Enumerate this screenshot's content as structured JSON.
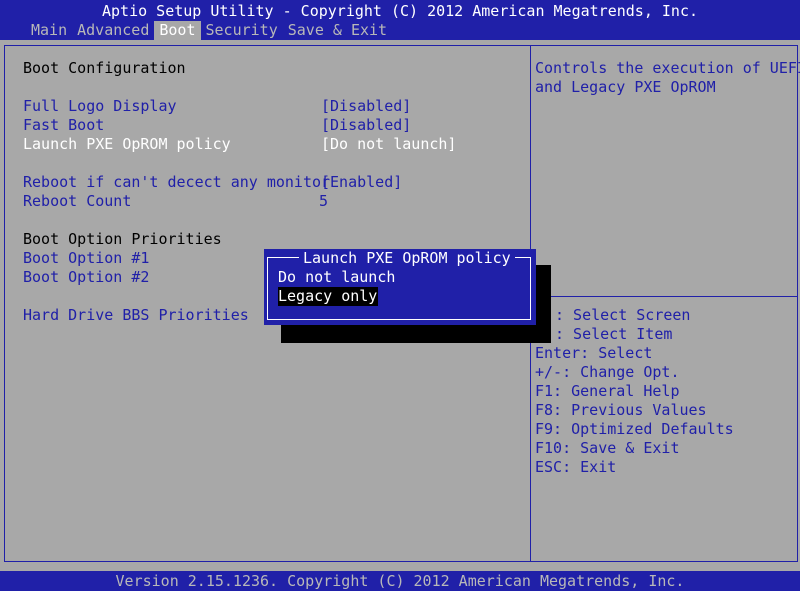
{
  "header": {
    "title": "Aptio Setup Utility - Copyright (C) 2012 American Megatrends, Inc.",
    "tabs": [
      {
        "label": "Main",
        "active": false
      },
      {
        "label": "Advanced",
        "active": false
      },
      {
        "label": "Boot",
        "active": true
      },
      {
        "label": "Security",
        "active": false
      },
      {
        "label": "Save & Exit",
        "active": false
      }
    ]
  },
  "main": {
    "section_title": "Boot Configuration",
    "settings": [
      {
        "label": "Full Logo Display",
        "value": "[Disabled]"
      },
      {
        "label": "Fast Boot",
        "value": "[Disabled]"
      },
      {
        "label": "Launch PXE OpROM policy",
        "value": "[Do not launch]"
      },
      {
        "label": "Reboot if can't decect any monitor",
        "value": "[Enabled]"
      },
      {
        "label": "Reboot Count",
        "value": "5"
      }
    ],
    "priorities_title": "Boot Option Priorities",
    "boot_options": [
      {
        "label": "Boot Option #1"
      },
      {
        "label": "Boot Option #2"
      }
    ],
    "hdd_bbs": "Hard Drive BBS Priorities"
  },
  "help": {
    "lines": [
      "Controls the execution of UEFI",
      "and Legacy PXE OpROM"
    ]
  },
  "keys": {
    "lines": [
      ": Select Screen",
      ": Select Item",
      "Enter: Select",
      "+/-: Change Opt.",
      "F1: General Help",
      "F8: Previous Values",
      "F9: Optimized Defaults",
      "F10: Save & Exit",
      "ESC: Exit"
    ]
  },
  "popup": {
    "title": "Launch PXE OpROM policy",
    "options": [
      {
        "label": "Do not launch",
        "selected": false
      },
      {
        "label": "Legacy only",
        "selected": true
      }
    ]
  },
  "footer": {
    "text": "Version 2.15.1236. Copyright (C) 2012 American Megatrends, Inc."
  },
  "colors": {
    "background": "#a8a8a8",
    "accent": "#2020a8",
    "highlight": "#ffffff",
    "selection": "#000000"
  }
}
